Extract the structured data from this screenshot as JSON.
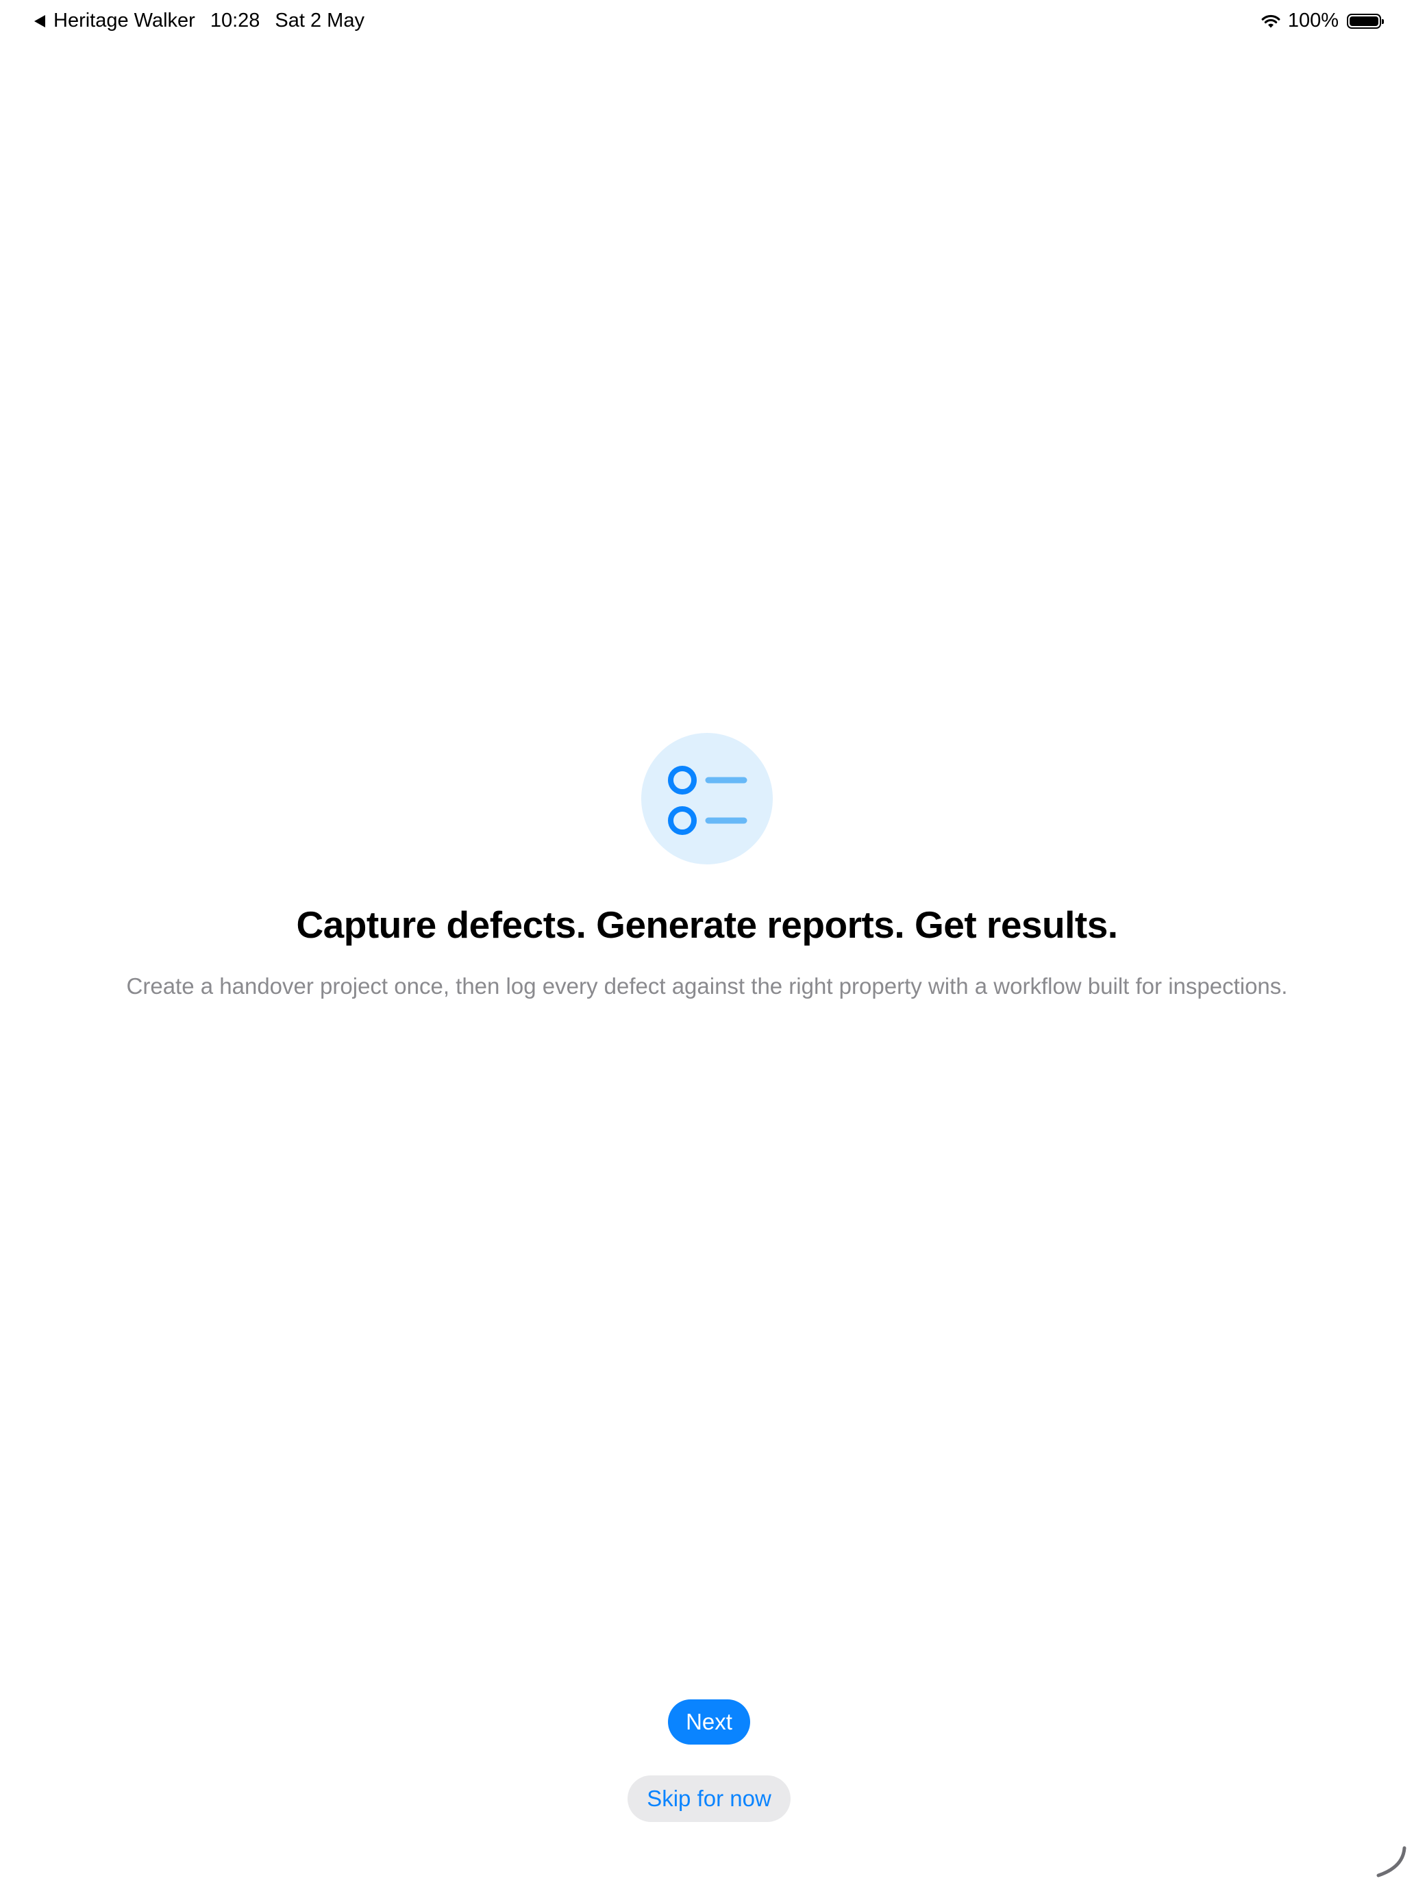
{
  "status_bar": {
    "back_app": "Heritage Walker",
    "time": "10:28",
    "date": "Sat 2 May",
    "battery_text": "100%",
    "battery_level": 1.0,
    "icons": [
      "back-arrow-icon",
      "wifi-icon",
      "battery-icon"
    ]
  },
  "onboarding": {
    "icon": "checklist-icon",
    "title": "Capture defects. Generate reports. Get results.",
    "description": "Create a handover project once, then log every defect against the right property with a workflow built for inspections."
  },
  "actions": {
    "next_label": "Next",
    "skip_label": "Skip for now"
  },
  "colors": {
    "accent": "#0a84ff",
    "accent_light": "#67b8f7",
    "icon_bg": "#dff0fd",
    "secondary_text": "#8a8a8e",
    "skip_bg": "#e9e9eb"
  }
}
